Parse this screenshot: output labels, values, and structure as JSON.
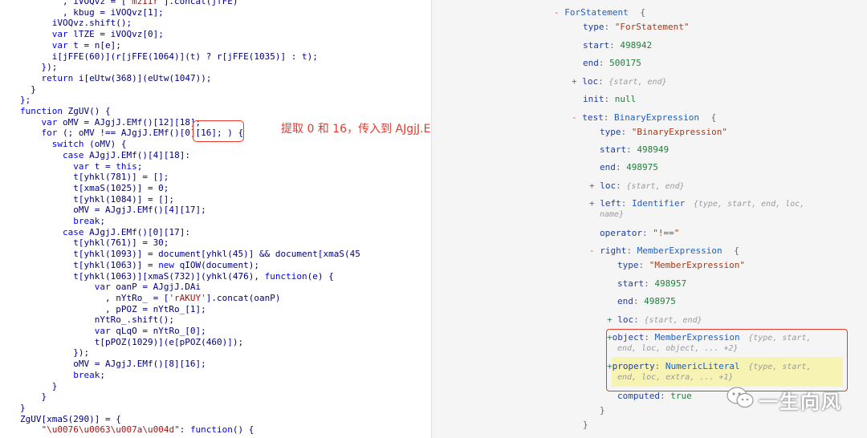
{
  "code_panel": {
    "lines": [
      "        , iVOQvz = ['mzIIr'].concat(jfFE)",
      "        , kbug = iVOQvz[1];",
      "      iVOQvz.shift();",
      "      var lTZE = iVOQvz[0];",
      "      var t = n[e];",
      "      i[jFFE(60)](r[jFFE(1064)](t) ? r[jFFE(1035)] : t);",
      "    });",
      "    return i[eUtw(368)](eUtw(1047));",
      "  }",
      "};",
      "function ZgUV() {",
      "    var oMV = AJgjJ.EMf()[12][18];",
      "    for (; oMV !== AJgjJ.EMf()[0][16]; ) {",
      "      switch (oMV) {",
      "        case AJgjJ.EMf()[4][18]:",
      "          var t = this;",
      "          t[yhkl(781)] = [];",
      "          t[xmaS(1025)] = 0;",
      "          t[yhkl(1084)] = [];",
      "          oMV = AJgjJ.EMf()[4][17];",
      "          break;",
      "        case AJgjJ.EMf()[0][17]:",
      "          t[yhkl(761)] = 30;",
      "          t[yhkl(1093)] = document[yhkl(45)] && document[xmaS(45",
      "          t[yhkl(1063)] = new qIOW(document);",
      "          t[yhkl(1063)][xmaS(732)](yhkl(476), function(e) {",
      "              var oanP = AJgjJ.DAi",
      "                , nYtRo_ = ['rAKUY'].concat(oanP)",
      "                , pPOZ = nYtRo_[1];",
      "              nYtRo_.shift();",
      "              var qLqO = nYtRo_[0];",
      "              t[pPOZ(1029)](e[pPOZ(460)]);",
      "          });",
      "          oMV = AJgjJ.EMf()[8][16];",
      "          break;",
      "      }",
      "    }",
      "}",
      "ZgUV[xmaS(290)] = {",
      "    \"\\u0076\\u0063\\u007a\\u004d\": function() {"
    ],
    "annotation": "提取 0 和 16，传入到 AJgjJ.EMf() 计算"
  },
  "ast_panel": {
    "root": {
      "key": "ForStatement",
      "brace": "{"
    },
    "type": {
      "key": "type",
      "value": "\"ForStatement\""
    },
    "start": {
      "key": "start",
      "value": "498942"
    },
    "end": {
      "key": "end",
      "value": "500175"
    },
    "loc": {
      "key": "loc",
      "summary": "{start, end}"
    },
    "init": {
      "key": "init",
      "value": "null"
    },
    "test": {
      "key": "test",
      "value": "BinaryExpression",
      "brace": "{",
      "type": {
        "key": "type",
        "value": "\"BinaryExpression\""
      },
      "start": {
        "key": "start",
        "value": "498949"
      },
      "end": {
        "key": "end",
        "value": "498975"
      },
      "loc": {
        "key": "loc",
        "summary": "{start, end}"
      },
      "left": {
        "key": "left",
        "value": "Identifier",
        "summary_1": "{type, start, end, loc,",
        "summary_2": "name}"
      },
      "operator": {
        "key": "operator",
        "value": "\"!==\""
      },
      "right": {
        "key": "right",
        "value": "MemberExpression",
        "brace": "{",
        "type": {
          "key": "type",
          "value": "\"MemberExpression\""
        },
        "start": {
          "key": "start",
          "value": "498957"
        },
        "end": {
          "key": "end",
          "value": "498975"
        },
        "loc": {
          "key": "loc",
          "summary": "{start, end}"
        },
        "object": {
          "key": "object",
          "value": "MemberExpression",
          "summary_1": "{type, start,",
          "summary_2": "end, loc, object, ... +2}"
        },
        "property": {
          "key": "property",
          "value": "NumericLiteral",
          "summary_1": "{type, start,",
          "summary_2": "end, loc, extra, ... +1}"
        },
        "computed": {
          "key": "computed",
          "value": "true"
        }
      }
    },
    "close_brace_1": "}",
    "close_brace_2": "}"
  },
  "toggles": {
    "expanded": "-",
    "collapsed": "+"
  },
  "watermark": {
    "text": "一生向风"
  },
  "colors": {
    "annotation_red": "#e8392b",
    "keyword_blue": "#0000ff",
    "string_red": "#a31515",
    "highlight_yellow": "#f7f3b3"
  }
}
